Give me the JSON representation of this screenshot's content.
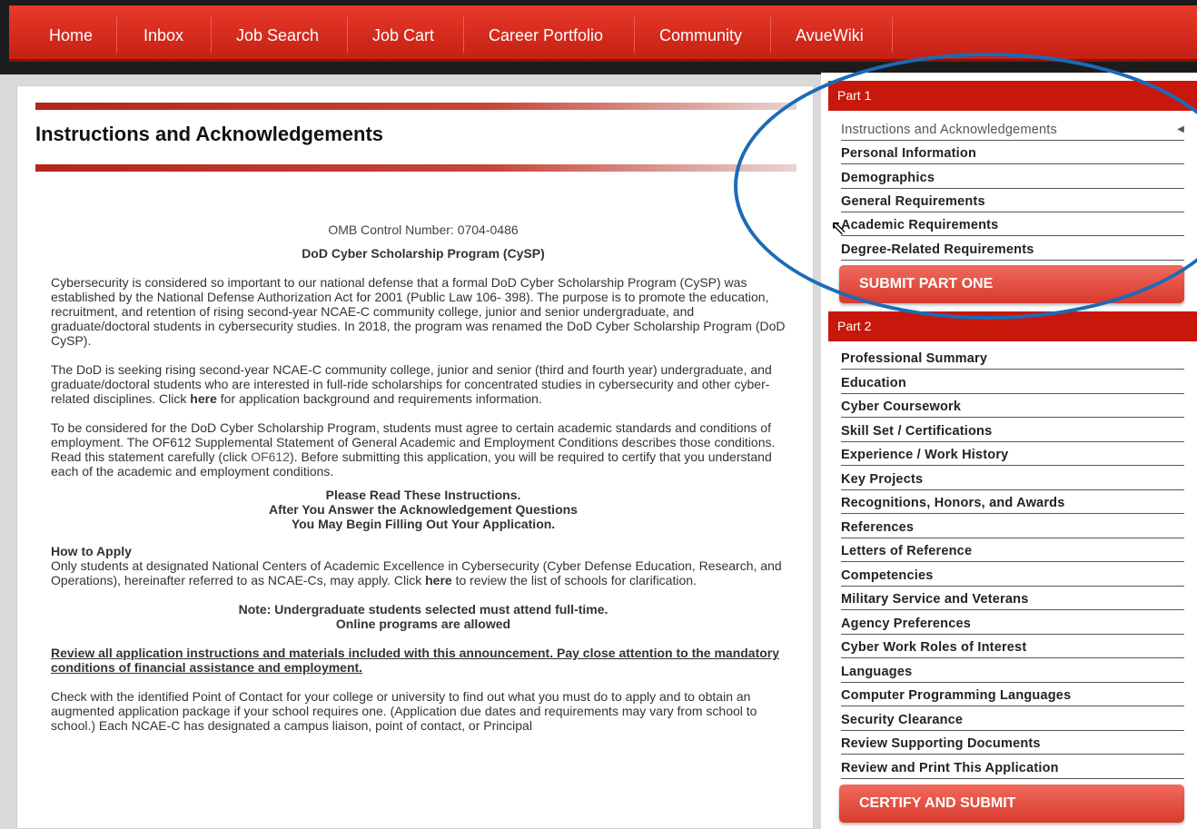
{
  "nav": {
    "items": [
      "Home",
      "Inbox",
      "Job Search",
      "Job Cart",
      "Career Portfolio",
      "Community",
      "AvueWiki"
    ]
  },
  "main": {
    "title": "Instructions and Acknowledgements",
    "omb": "OMB Control Number: 0704-0486",
    "program": "DoD Cyber Scholarship Program (CySP)",
    "p1": "Cybersecurity is considered so important to our national defense that a formal DoD Cyber Scholarship Program (CySP) was established by the National Defense Authorization Act for 2001 (Public Law 106- 398). The purpose is to promote the education, recruitment, and retention of rising second-year NCAE-C community college, junior and senior undergraduate, and graduate/doctoral students in cybersecurity studies. In 2018, the program was renamed the DoD Cyber Scholarship Program (DoD CySP).",
    "p2_a": "The DoD is seeking rising second-year NCAE-C community college, junior and senior (third and fourth year) undergraduate, and graduate/doctoral students who are interested in full-ride scholarships for concentrated studies in cybersecurity and other cyber-related disciplines. Click ",
    "p2_link": "here",
    "p2_b": " for application background and requirements information.",
    "p3_a": "To be considered for the DoD Cyber Scholarship Program, students must agree to certain academic standards and conditions of employment. The OF612 Supplemental Statement of General Academic and Employment Conditions describes those conditions. Read this statement carefully (click ",
    "p3_link": "OF612",
    "p3_b": "). Before submitting this application, you will be required to certify that you understand each of the academic and employment conditions.",
    "notice1": "Please Read These Instructions.",
    "notice2": "After You Answer the Acknowledgement Questions",
    "notice3": "You May Begin Filling Out Your Application.",
    "how_heading": "How to Apply",
    "how_a": "Only students at designated National Centers of Academic Excellence in Cybersecurity (Cyber Defense Education, Research, and Operations), hereinafter referred to as NCAE-Cs, may apply. Click ",
    "how_link": "here",
    "how_b": " to review the list of schools for clarification.",
    "note1": "Note: Undergraduate students selected must attend full-time.",
    "note2": "Online programs are allowed",
    "review": "Review all application instructions and materials included with this announcement. Pay close attention to the mandatory conditions of financial assistance and employment.",
    "check": "Check with the identified Point of Contact for your college or university to find out what you must do to apply and to obtain an augmented application package if your school requires one. (Application due dates and requirements may vary from school to school.) Each NCAE-C has designated a campus liaison, point of contact, or Principal"
  },
  "sidebar": {
    "part1_label": "Part 1",
    "part1_items": [
      "Instructions and Acknowledgements",
      "Personal Information",
      "Demographics",
      "General Requirements",
      "Academic Requirements",
      "Degree-Related Requirements"
    ],
    "submit_part_one": "SUBMIT PART ONE",
    "part2_label": "Part 2",
    "part2_items": [
      "Professional Summary",
      "Education",
      "Cyber Coursework",
      "Skill Set / Certifications",
      "Experience / Work History",
      "Key Projects",
      "Recognitions, Honors, and Awards",
      "References",
      "Letters of Reference",
      "Competencies",
      "Military Service and Veterans",
      "Agency Preferences",
      "Cyber Work Roles of Interest",
      "Languages",
      "Computer Programming Languages",
      "Security Clearance",
      "Review Supporting Documents",
      "Review and Print This Application"
    ],
    "certify": "CERTIFY AND SUBMIT"
  },
  "colors": {
    "accent_red": "#c8180c",
    "annotation_blue": "#1b6bb8"
  }
}
